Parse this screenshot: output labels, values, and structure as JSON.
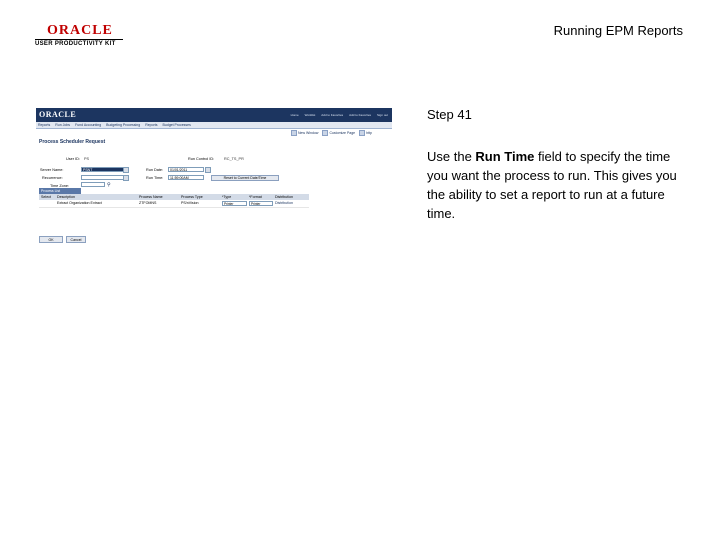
{
  "logo": {
    "brand": "ORACLE",
    "product": "USER PRODUCTIVITY KIT"
  },
  "doc_title": "Running EPM Reports",
  "step": {
    "label": "Step 41",
    "text_before": "Use the ",
    "text_bold": "Run Time",
    "text_after": " field to specify the time you want the process to run. This gives you the ability to set a report to run at a future time."
  },
  "screenshot": {
    "brand": "ORACLE",
    "top_links": [
      "Home",
      "Worklist",
      "Add to Favorites",
      "Add to Favorites",
      "Sign out"
    ],
    "menus": [
      "Reports",
      "Run Jobs",
      "Fund Accounting",
      "Budgeting Processing",
      "Reports",
      "Budget Processes"
    ],
    "page_links": [
      "New Window",
      "Customize Page",
      "http"
    ],
    "page_title": "Process Scheduler Request",
    "user_id_label": "User ID:",
    "user_id_value": "PS",
    "run_control_label": "Run Control ID:",
    "run_control_value": "RC_TS_PR",
    "server_name_label": "Server Name:",
    "server_name_value": "PSNT",
    "run_date_label": "Run Date:",
    "run_date_value": "01/01/2011",
    "recurrence_label": "Recurrence:",
    "run_time_label": "Run Time:",
    "run_time_value": "11:59:00AM",
    "reset_button": "Reset to Current Date/Time",
    "time_zone_label": "Time Zone:",
    "process_list_title": "Process List",
    "columns": [
      "Select",
      "Description",
      "Process Name",
      "Process Type",
      "*Type",
      "*Format",
      "Distribution"
    ],
    "rows": [
      {
        "select": "",
        "description": "Extract Organization Extract",
        "process_name": "ZTFOMNS",
        "process_type": "PS/nVision",
        "type": "Printer",
        "format": "Printer",
        "distribution": "Distribution"
      }
    ],
    "ok_button": "OK",
    "cancel_button": "Cancel"
  }
}
